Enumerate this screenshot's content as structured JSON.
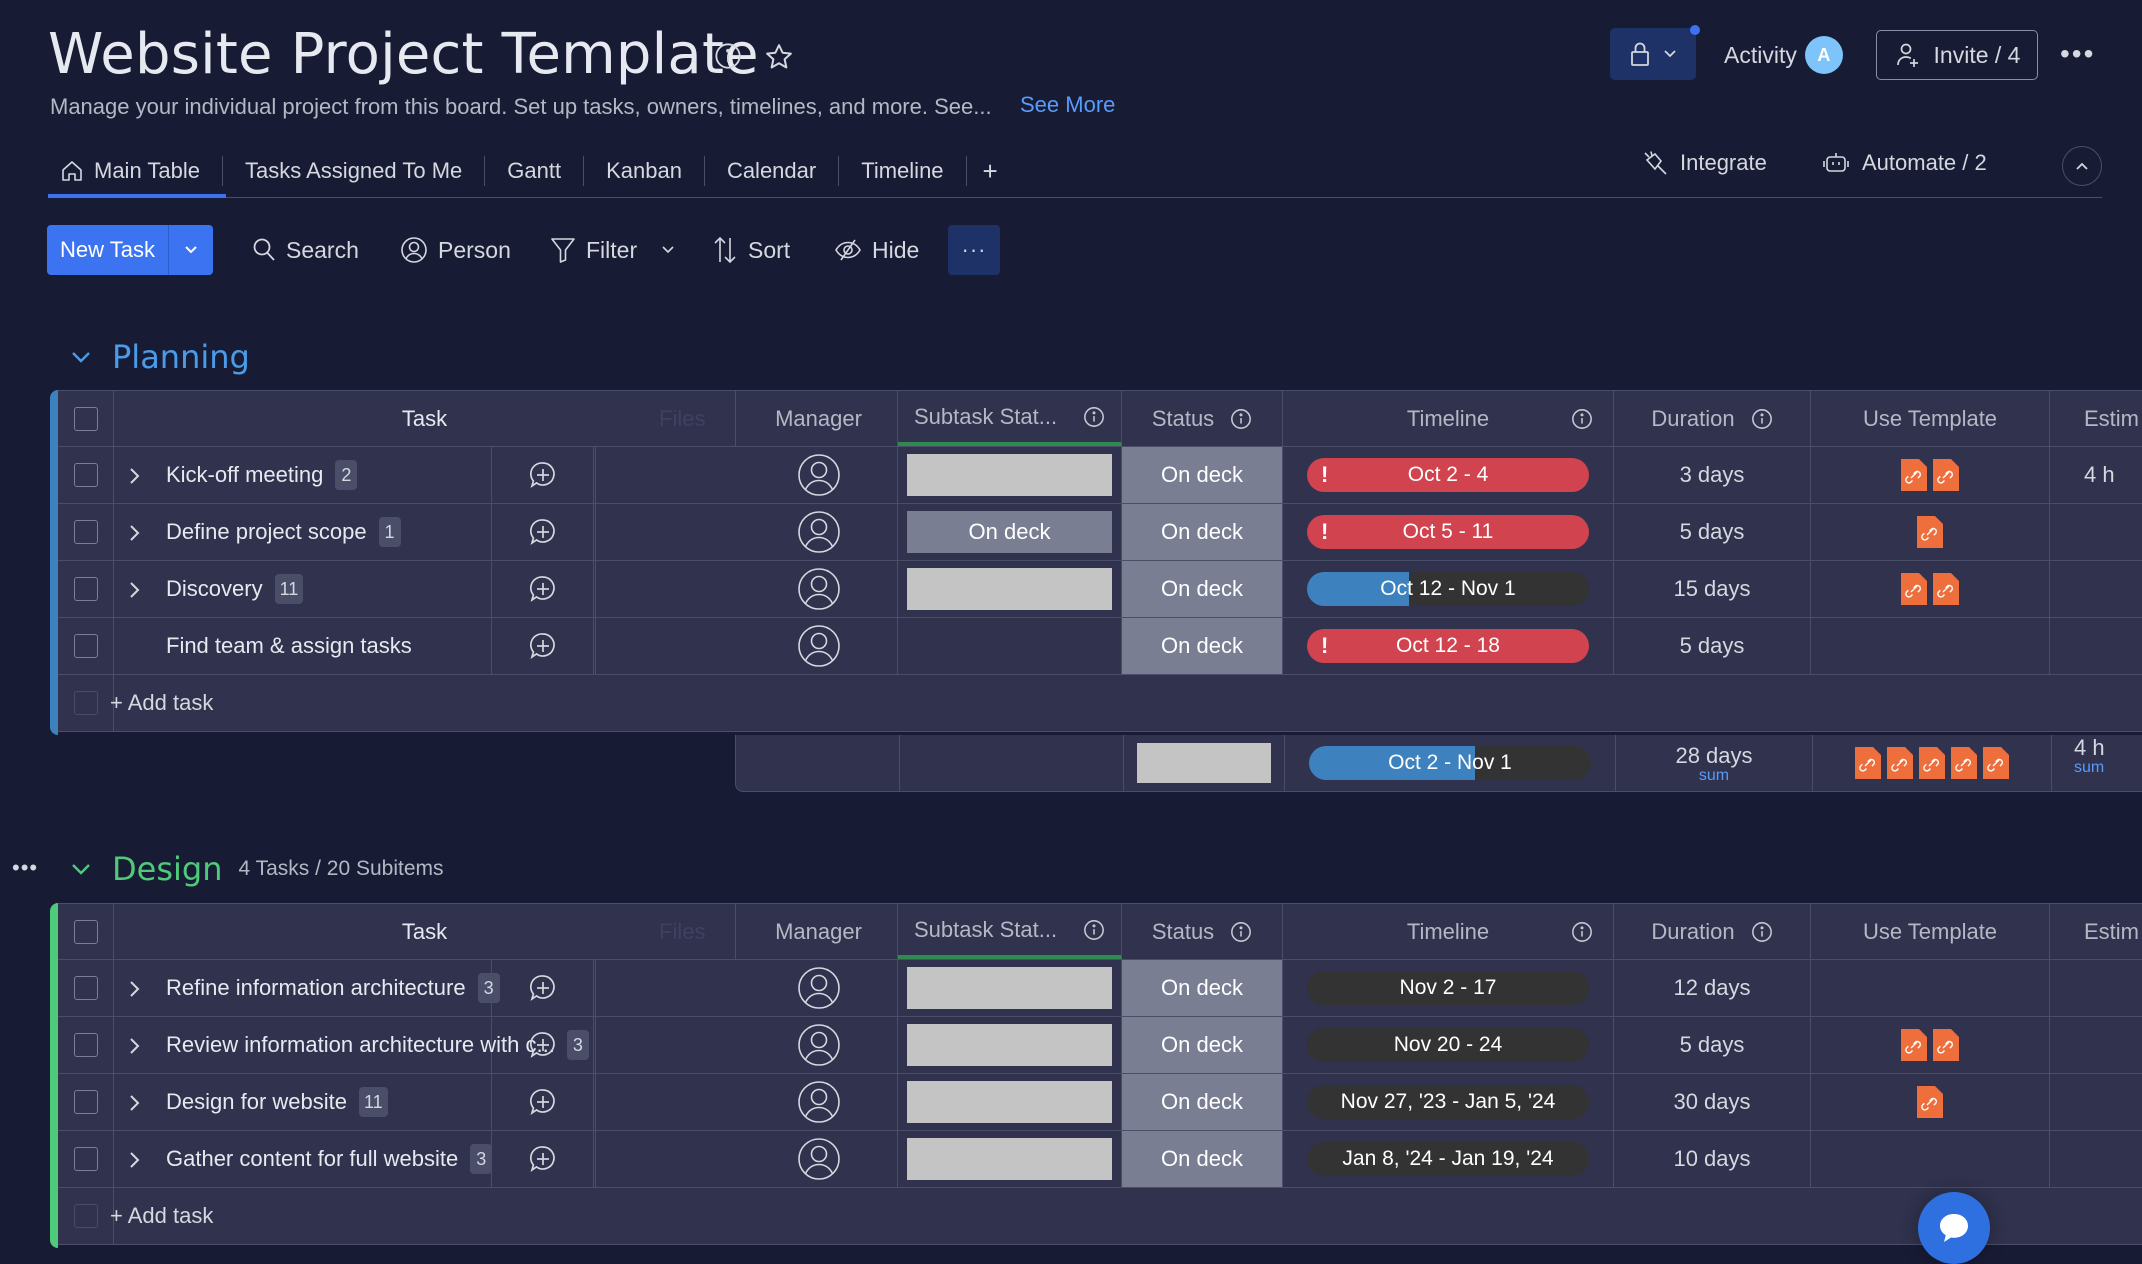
{
  "header": {
    "title": "Website Project Template",
    "description": "Manage your individual project from this board. Set up tasks, owners, timelines, and more. See...",
    "see_more": "See More",
    "activity_label": "Activity",
    "activity_avatar": "A",
    "invite_label": "Invite / 4",
    "icons": {
      "info": "info-icon",
      "favorite": "star-icon",
      "lock": "lock-icon",
      "more": "more-horizontal-icon"
    }
  },
  "tabs": [
    {
      "label": "Main Table",
      "icon": "home-icon",
      "active": true
    },
    {
      "label": "Tasks Assigned To Me"
    },
    {
      "label": "Gantt"
    },
    {
      "label": "Kanban"
    },
    {
      "label": "Calendar"
    },
    {
      "label": "Timeline"
    }
  ],
  "tab_add": "+",
  "board_actions": {
    "integrate": "Integrate",
    "automate": "Automate / 2"
  },
  "toolbar": {
    "new_task": "New Task",
    "search": "Search",
    "person": "Person",
    "filter": "Filter",
    "sort": "Sort",
    "hide": "Hide",
    "more": "···"
  },
  "columns": {
    "task": "Task",
    "files": "Files",
    "manager": "Manager",
    "subtask_status": "Subtask Stat...",
    "status": "Status",
    "timeline": "Timeline",
    "duration": "Duration",
    "use_template": "Use Template",
    "estimation": "Estim"
  },
  "colors": {
    "background": "#181b34",
    "row": "#30324e",
    "planning": "#3d82be",
    "planning_title": "#4a9ce8",
    "design": "#4eca7a",
    "accent": "#3b73f0",
    "timeline_overdue": "#d0434f",
    "status_on_deck": "#797e93",
    "template_file": "#ee6f3b"
  },
  "groups": [
    {
      "name": "Planning",
      "meta": "",
      "add_task": "+ Add task",
      "rows": [
        {
          "task": "Kick-off meeting",
          "subitems": "2",
          "subtask_status": "empty",
          "status": "On deck",
          "timeline": "Oct 2 - 4",
          "timeline_state": "overdue",
          "timeline_progress": null,
          "duration": "3 days",
          "templates": 2,
          "estimation": "4 h"
        },
        {
          "task": "Define project scope",
          "subitems": "1",
          "subtask_status": "On deck",
          "status": "On deck",
          "timeline": "Oct 5 - 11",
          "timeline_state": "overdue",
          "timeline_progress": null,
          "duration": "5 days",
          "templates": 1,
          "estimation": ""
        },
        {
          "task": "Discovery",
          "subitems": "11",
          "subtask_status": "empty",
          "status": "On deck",
          "timeline": "Oct 12 - Nov 1",
          "timeline_state": "progress",
          "timeline_progress": 0.36,
          "duration": "15 days",
          "templates": 2,
          "estimation": ""
        },
        {
          "task": "Find team & assign tasks",
          "subitems": "",
          "subtask_status": "none",
          "status": "On deck",
          "timeline": "Oct 12 - 18",
          "timeline_state": "overdue",
          "timeline_progress": null,
          "duration": "5 days",
          "templates": 0,
          "estimation": ""
        }
      ],
      "summary": {
        "timeline": "Oct 2 - Nov 1",
        "timeline_progress": 0.59,
        "duration": "28 days",
        "duration_fn": "sum",
        "templates": 5,
        "estimation": "4 h",
        "estimation_fn": "sum"
      }
    },
    {
      "name": "Design",
      "meta": "4 Tasks / 20 Subitems",
      "add_task": "+ Add task",
      "rows": [
        {
          "task": "Refine information architecture",
          "subitems": "3",
          "subtask_status": "empty",
          "status": "On deck",
          "timeline": "Nov 2 - 17",
          "timeline_state": "future",
          "timeline_progress": null,
          "duration": "12 days",
          "templates": 0,
          "estimation": ""
        },
        {
          "task": "Review information architecture with c...",
          "subitems": "3",
          "subtask_status": "empty",
          "status": "On deck",
          "timeline": "Nov 20 - 24",
          "timeline_state": "future",
          "timeline_progress": null,
          "duration": "5 days",
          "templates": 2,
          "estimation": ""
        },
        {
          "task": "Design for website",
          "subitems": "11",
          "subtask_status": "empty",
          "status": "On deck",
          "timeline": "Nov 27, '23 - Jan 5, '24",
          "timeline_state": "future",
          "timeline_progress": null,
          "duration": "30 days",
          "templates": 1,
          "estimation": ""
        },
        {
          "task": "Gather content for full website",
          "subitems": "3",
          "subtask_status": "empty",
          "status": "On deck",
          "timeline": "Jan 8, '24 - Jan 19, '24",
          "timeline_state": "future",
          "timeline_progress": null,
          "duration": "10 days",
          "templates": 0,
          "estimation": ""
        }
      ]
    }
  ]
}
